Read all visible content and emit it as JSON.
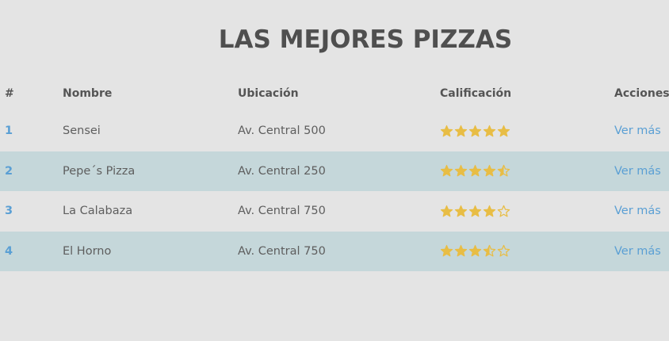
{
  "title": "LAS MEJORES PIZZAS",
  "columns": {
    "num": "#",
    "name": "Nombre",
    "location": "Ubicación",
    "rating": "Calificación",
    "actions": "Acciones"
  },
  "rows": [
    {
      "num": "1",
      "name": "Sensei",
      "location": "Av. Central 500",
      "rating": 5,
      "action": "Ver más"
    },
    {
      "num": "2",
      "name": "Pepe´s Pizza",
      "location": "Av. Central 250",
      "rating": 4.5,
      "action": "Ver más"
    },
    {
      "num": "3",
      "name": "La Calabaza",
      "location": "Av. Central 750",
      "rating": 4,
      "action": "Ver más"
    },
    {
      "num": "4",
      "name": "El Horno",
      "location": "Av. Central 750",
      "rating": 3.5,
      "action": "Ver más"
    }
  ],
  "colors": {
    "background": "#e4e4e4",
    "row_alt": "#c5d7da",
    "link": "#5a9fd4",
    "star": "#e8bd45"
  },
  "icons": {
    "full": "star-full-icon",
    "half": "star-half-icon",
    "empty": "star-empty-icon"
  }
}
